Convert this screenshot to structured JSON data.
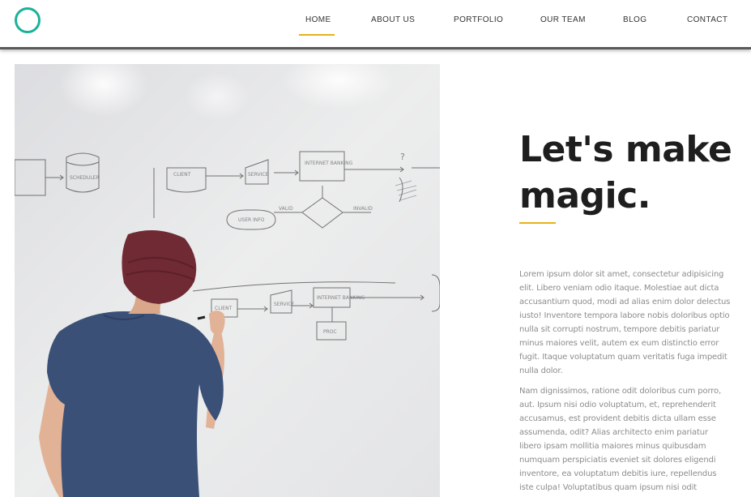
{
  "header": {
    "nav": [
      {
        "label": "HOME",
        "active": true
      },
      {
        "label": "ABOUT US"
      },
      {
        "label": "PORTFOLIO"
      },
      {
        "label": "OUR TEAM"
      },
      {
        "label": "BLOG"
      },
      {
        "label": "CONTACT"
      }
    ]
  },
  "colors": {
    "accent": "#e6b21a",
    "logo": "#1ab19a",
    "headline": "#1e1e1e",
    "body_text": "#8c8c8c"
  },
  "hero": {
    "headline_line1": "Let's make",
    "headline_line2": "magic.",
    "paragraph1": "Lorem ipsum dolor sit amet, consectetur adipisicing elit. Libero veniam odio itaque. Molestiae aut dicta accusantium quod, modi ad alias enim dolor delectus iusto! Inventore tempora labore nobis doloribus optio nulla sit corrupti nostrum, tempore debitis pariatur minus maiores velit, autem ex eum distinctio error fugit. Itaque voluptatum quam veritatis fuga impedit nulla dolor.",
    "paragraph2": "Nam dignissimos, ratione odit doloribus cum porro, aut. Ipsum nisi odio voluptatum, et, reprehenderit accusamus, est provident debitis dicta ullam esse assumenda, odit? Alias architecto enim pariatur libero ipsam mollitia maiores minus quibusdam numquam perspiciatis eveniet sit dolores eligendi inventore, ea voluptatum debitis iure, repellendus iste culpa! Voluptatibus quam ipsum nisi odit"
  },
  "photo": {
    "whiteboard_labels": [
      "SCHEDULER",
      "CLIENT",
      "SERVICE",
      "INTERNET BANKING",
      "USER INFO",
      "VALID",
      "INVALID",
      "?",
      "CLIENT",
      "SERVICE",
      "INTERNET BANKING",
      "PROC"
    ]
  }
}
